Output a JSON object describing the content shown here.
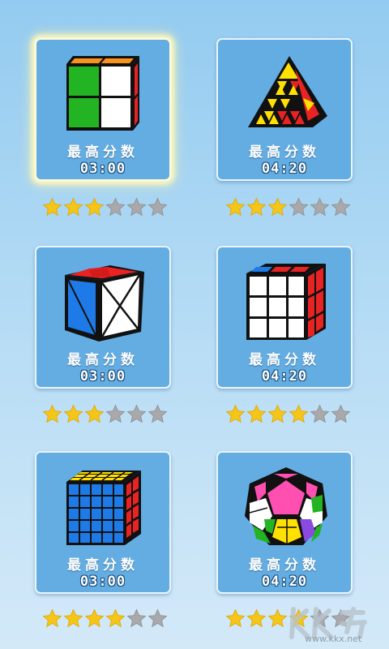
{
  "levels": [
    {
      "best_label": "最高分数",
      "best_time": "03:00",
      "stars": 3,
      "puzzle_icon": "cube-2x2-icon",
      "selected": true
    },
    {
      "best_label": "最高分数",
      "best_time": "04:20",
      "stars": 3,
      "puzzle_icon": "pyraminx-icon",
      "selected": false
    },
    {
      "best_label": "最高分数",
      "best_time": "03:00",
      "stars": 3,
      "puzzle_icon": "skewb-icon",
      "selected": false
    },
    {
      "best_label": "最高分数",
      "best_time": "04:20",
      "stars": 4,
      "puzzle_icon": "cube-3x3-icon",
      "selected": false
    },
    {
      "best_label": "最高分数",
      "best_time": "03:00",
      "stars": 4,
      "puzzle_icon": "cube-5x5-icon",
      "selected": false
    },
    {
      "best_label": "最高分数",
      "best_time": "04:20",
      "stars": 4,
      "puzzle_icon": "megaminx-icon",
      "selected": false
    }
  ],
  "max_stars": 6,
  "colors": {
    "star_on": "#f5c518",
    "star_off": "#a9a9ab",
    "card": "#63ade3"
  },
  "watermark": {
    "text": "www.kkx.net",
    "logo": "kkx-logo"
  }
}
